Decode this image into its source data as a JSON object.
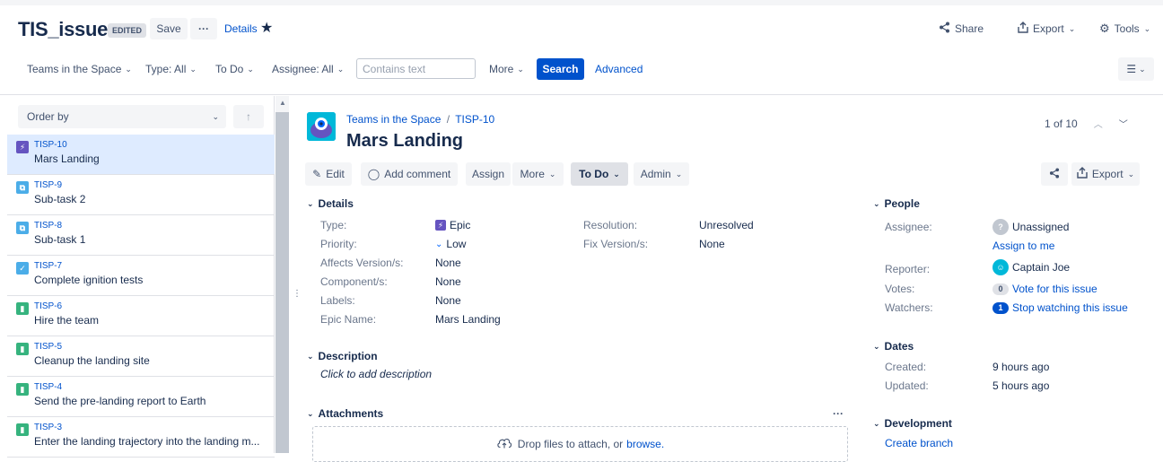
{
  "header": {
    "filter_name": "TIS_issues",
    "edited_label": "EDITED",
    "save_label": "Save",
    "more_label": "···",
    "details_label": "Details",
    "share_label": "Share",
    "export_label": "Export",
    "tools_label": "Tools"
  },
  "filterbar": {
    "project": "Teams in the Space",
    "type": "Type: All",
    "status": "To Do",
    "assignee": "Assignee: All",
    "text_placeholder": "Contains text",
    "more": "More",
    "search": "Search",
    "advanced": "Advanced"
  },
  "issue_list": {
    "order_by": "Order by",
    "items": [
      {
        "key": "TISP-10",
        "summary": "Mars Landing",
        "type": "epic",
        "icon": "⚡",
        "color": "#6554c0"
      },
      {
        "key": "TISP-9",
        "summary": "Sub-task 2",
        "type": "subtask",
        "icon": "⧉",
        "color": "#4bade8"
      },
      {
        "key": "TISP-8",
        "summary": "Sub-task 1",
        "type": "subtask",
        "icon": "⧉",
        "color": "#4bade8"
      },
      {
        "key": "TISP-7",
        "summary": "Complete ignition tests",
        "type": "task",
        "icon": "✓",
        "color": "#4bade8"
      },
      {
        "key": "TISP-6",
        "summary": "Hire the team",
        "type": "story",
        "icon": "▮",
        "color": "#36b37e"
      },
      {
        "key": "TISP-5",
        "summary": "Cleanup the landing site",
        "type": "story",
        "icon": "▮",
        "color": "#36b37e"
      },
      {
        "key": "TISP-4",
        "summary": "Send the pre-landing report to Earth",
        "type": "story",
        "icon": "▮",
        "color": "#36b37e"
      },
      {
        "key": "TISP-3",
        "summary": "Enter the landing trajectory into the landing m...",
        "type": "story",
        "icon": "▮",
        "color": "#36b37e"
      }
    ]
  },
  "issue": {
    "project": "Teams in the Space",
    "separator": "/",
    "key": "TISP-10",
    "title": "Mars Landing",
    "pager": "1 of 10",
    "toolbar": {
      "edit": "Edit",
      "add_comment": "Add comment",
      "assign": "Assign",
      "more": "More",
      "status": "To Do",
      "admin": "Admin",
      "export": "Export"
    },
    "details": {
      "heading": "Details",
      "type_label": "Type:",
      "type_value": "Epic",
      "priority_label": "Priority:",
      "priority_value": "Low",
      "affects_label": "Affects Version/s:",
      "affects_value": "None",
      "components_label": "Component/s:",
      "components_value": "None",
      "labels_label": "Labels:",
      "labels_value": "None",
      "epic_name_label": "Epic Name:",
      "epic_name_value": "Mars Landing",
      "resolution_label": "Resolution:",
      "resolution_value": "Unresolved",
      "fix_label": "Fix Version/s:",
      "fix_value": "None"
    },
    "description": {
      "heading": "Description",
      "placeholder": "Click to add description"
    },
    "attachments": {
      "heading": "Attachments",
      "more": "···",
      "drop_text": "Drop files to attach, or",
      "browse": "browse."
    },
    "people": {
      "heading": "People",
      "assignee_label": "Assignee:",
      "assignee_value": "Unassigned",
      "assign_to_me": "Assign to me",
      "reporter_label": "Reporter:",
      "reporter_value": "Captain Joe",
      "votes_label": "Votes:",
      "votes_count": "0",
      "votes_link": "Vote for this issue",
      "watchers_label": "Watchers:",
      "watchers_count": "1",
      "watchers_link": "Stop watching this issue"
    },
    "dates": {
      "heading": "Dates",
      "created_label": "Created:",
      "created_value": "9 hours ago",
      "updated_label": "Updated:",
      "updated_value": "5 hours ago"
    },
    "development": {
      "heading": "Development",
      "create_branch": "Create branch"
    }
  }
}
